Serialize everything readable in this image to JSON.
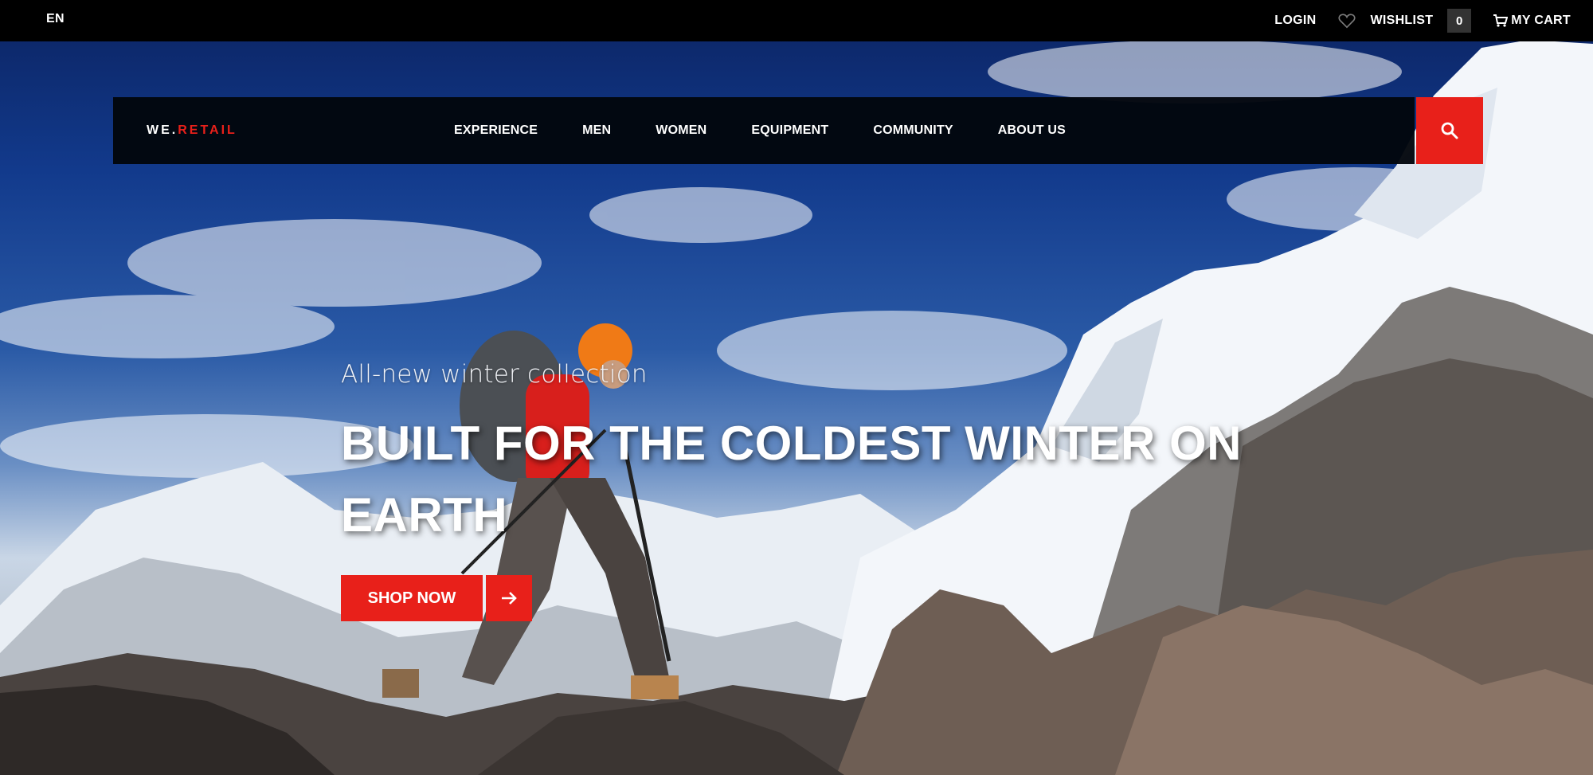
{
  "topbar": {
    "language": "EN",
    "login": "LOGIN",
    "wishlist": "WISHLIST",
    "wishlist_count": "0",
    "cart": "MY CART"
  },
  "nav": {
    "logo_prefix": "WE.",
    "logo_accent": "RETAIL",
    "items": [
      "EXPERIENCE",
      "MEN",
      "WOMEN",
      "EQUIPMENT",
      "COMMUNITY",
      "ABOUT US"
    ]
  },
  "hero": {
    "subtitle": "All-new winter collection",
    "headline": "BUILT FOR THE COLDEST WINTER ON EARTH",
    "cta_label": "SHOP NOW"
  },
  "icons": {
    "search": "search-icon",
    "heart": "heart-icon",
    "cart": "cart-icon",
    "arrow": "arrow-right-icon"
  },
  "colors": {
    "accent": "#e8201a",
    "topbar": "#000000",
    "nav": "#02060c"
  }
}
